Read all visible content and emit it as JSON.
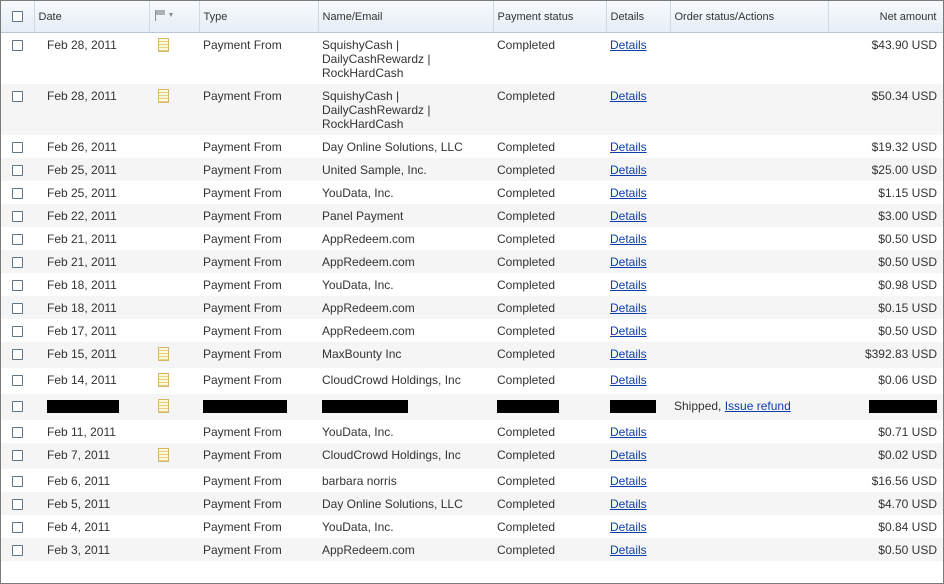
{
  "columns": {
    "date": "Date",
    "type": "Type",
    "name": "Name/Email",
    "status": "Payment status",
    "details": "Details",
    "order": "Order status/Actions",
    "amount": "Net amount"
  },
  "icons": {
    "flag": "flag-icon",
    "note": "note-icon",
    "caret": "chevron-down-icon"
  },
  "rows": [
    {
      "date": "Feb 28, 2011",
      "note": true,
      "type": "Payment From",
      "name": [
        "SquishyCash |",
        "DailyCashRewardz |",
        "RockHardCash"
      ],
      "status": "Completed",
      "details": "Details",
      "amount": "$43.90 USD"
    },
    {
      "date": "Feb 28, 2011",
      "note": true,
      "type": "Payment From",
      "name": [
        "SquishyCash |",
        "DailyCashRewardz |",
        "RockHardCash"
      ],
      "status": "Completed",
      "details": "Details",
      "amount": "$50.34 USD"
    },
    {
      "date": "Feb 26, 2011",
      "note": false,
      "type": "Payment From",
      "name": [
        "Day Online Solutions, LLC"
      ],
      "status": "Completed",
      "details": "Details",
      "amount": "$19.32 USD"
    },
    {
      "date": "Feb 25, 2011",
      "note": false,
      "type": "Payment From",
      "name": [
        "United Sample, Inc."
      ],
      "status": "Completed",
      "details": "Details",
      "amount": "$25.00 USD"
    },
    {
      "date": "Feb 25, 2011",
      "note": false,
      "type": "Payment From",
      "name": [
        "YouData, Inc."
      ],
      "status": "Completed",
      "details": "Details",
      "amount": "$1.15 USD"
    },
    {
      "date": "Feb 22, 2011",
      "note": false,
      "type": "Payment From",
      "name": [
        "Panel Payment"
      ],
      "status": "Completed",
      "details": "Details",
      "amount": "$3.00 USD"
    },
    {
      "date": "Feb 21, 2011",
      "note": false,
      "type": "Payment From",
      "name": [
        "AppRedeem.com"
      ],
      "status": "Completed",
      "details": "Details",
      "amount": "$0.50 USD"
    },
    {
      "date": "Feb 21, 2011",
      "note": false,
      "type": "Payment From",
      "name": [
        "AppRedeem.com"
      ],
      "status": "Completed",
      "details": "Details",
      "amount": "$0.50 USD"
    },
    {
      "date": "Feb 18, 2011",
      "note": false,
      "type": "Payment From",
      "name": [
        "YouData, Inc."
      ],
      "status": "Completed",
      "details": "Details",
      "amount": "$0.98 USD"
    },
    {
      "date": "Feb 18, 2011",
      "note": false,
      "type": "Payment From",
      "name": [
        "AppRedeem.com"
      ],
      "status": "Completed",
      "details": "Details",
      "amount": "$0.15 USD"
    },
    {
      "date": "Feb 17, 2011",
      "note": false,
      "type": "Payment From",
      "name": [
        "AppRedeem.com"
      ],
      "status": "Completed",
      "details": "Details",
      "amount": "$0.50 USD"
    },
    {
      "date": "Feb 15, 2011",
      "note": true,
      "type": "Payment From",
      "name": [
        "MaxBounty Inc"
      ],
      "status": "Completed",
      "details": "Details",
      "amount": "$392.83 USD"
    },
    {
      "date": "Feb 14, 2011",
      "note": true,
      "type": "Payment From",
      "name": [
        "CloudCrowd Holdings, Inc"
      ],
      "status": "Completed",
      "details": "Details",
      "amount": "$0.06 USD"
    },
    {
      "redacted": true,
      "note": true,
      "order_status": "Shipped, ",
      "order_action": "Issue refund"
    },
    {
      "date": "Feb 11, 2011",
      "note": false,
      "type": "Payment From",
      "name": [
        "YouData, Inc."
      ],
      "status": "Completed",
      "details": "Details",
      "amount": "$0.71 USD"
    },
    {
      "date": "Feb 7, 2011",
      "note": true,
      "type": "Payment From",
      "name": [
        "CloudCrowd Holdings, Inc"
      ],
      "status": "Completed",
      "details": "Details",
      "amount": "$0.02 USD"
    },
    {
      "date": "Feb 6, 2011",
      "note": false,
      "type": "Payment From",
      "name": [
        "barbara norris"
      ],
      "status": "Completed",
      "details": "Details",
      "amount": "$16.56 USD"
    },
    {
      "date": "Feb 5, 2011",
      "note": false,
      "type": "Payment From",
      "name": [
        "Day Online Solutions, LLC"
      ],
      "status": "Completed",
      "details": "Details",
      "amount": "$4.70 USD"
    },
    {
      "date": "Feb 4, 2011",
      "note": false,
      "type": "Payment From",
      "name": [
        "YouData, Inc."
      ],
      "status": "Completed",
      "details": "Details",
      "amount": "$0.84 USD"
    },
    {
      "date": "Feb 3, 2011",
      "note": false,
      "type": "Payment From",
      "name": [
        "AppRedeem.com"
      ],
      "status": "Completed",
      "details": "Details",
      "amount": "$0.50 USD"
    }
  ]
}
